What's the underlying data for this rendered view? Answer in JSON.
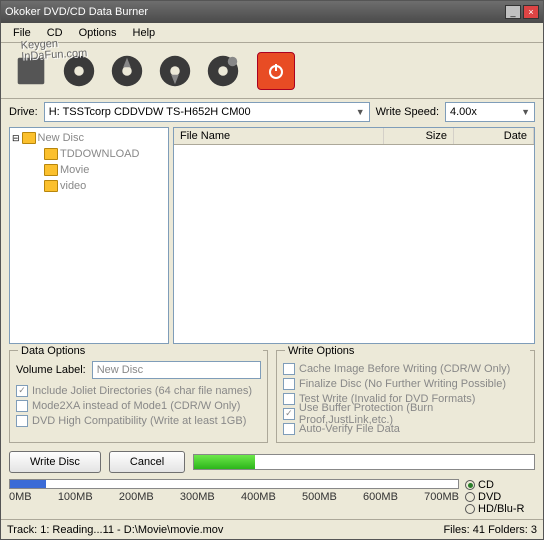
{
  "window": {
    "title": "Okoker DVD/CD Data Burner"
  },
  "watermark": {
    "line1": "Keygen",
    "line2": "InDaFun.com"
  },
  "menu": {
    "file": "File",
    "cd": "CD",
    "options": "Options",
    "help": "Help"
  },
  "toolbar": {
    "power": "power"
  },
  "drive": {
    "label": "Drive:",
    "value": "H: TSSTcorp CDDVDW TS-H652H CM00",
    "speed_label": "Write Speed:",
    "speed_value": "4.00x"
  },
  "tree": {
    "root": "New Disc",
    "items": [
      "TDDOWNLOAD",
      "Movie",
      "video"
    ]
  },
  "list": {
    "cols": {
      "name": "File Name",
      "size": "Size",
      "date": "Date"
    }
  },
  "data_options": {
    "legend": "Data Options",
    "vol_label": "Volume Label:",
    "vol_value": "New Disc",
    "joliet": "Include Joliet Directories (64 char file names)",
    "mode2": "Mode2XA instead of Mode1 (CDR/W Only)",
    "dvdhc": "DVD High Compatibility (Write at least 1GB)"
  },
  "write_options": {
    "legend": "Write Options",
    "cache": "Cache Image Before Writing (CDR/W Only)",
    "finalize": "Finalize Disc (No Further Writing Possible)",
    "test": "Test Write (Invalid for DVD Formats)",
    "buffer": "Use Buffer Protection (Burn Proof,JustLink,etc.)",
    "verify": "Auto-Verify File Data"
  },
  "actions": {
    "write": "Write Disc",
    "cancel": "Cancel"
  },
  "capacity": {
    "ticks": [
      "0MB",
      "100MB",
      "200MB",
      "300MB",
      "400MB",
      "500MB",
      "600MB",
      "700MB"
    ],
    "types": {
      "cd": "CD",
      "dvd": "DVD",
      "hd": "HD/Blu-R"
    }
  },
  "status": {
    "left": "Track:   1: Reading...11 - D:\\Movie\\movie.mov",
    "right": "Files: 41  Folders: 3"
  }
}
